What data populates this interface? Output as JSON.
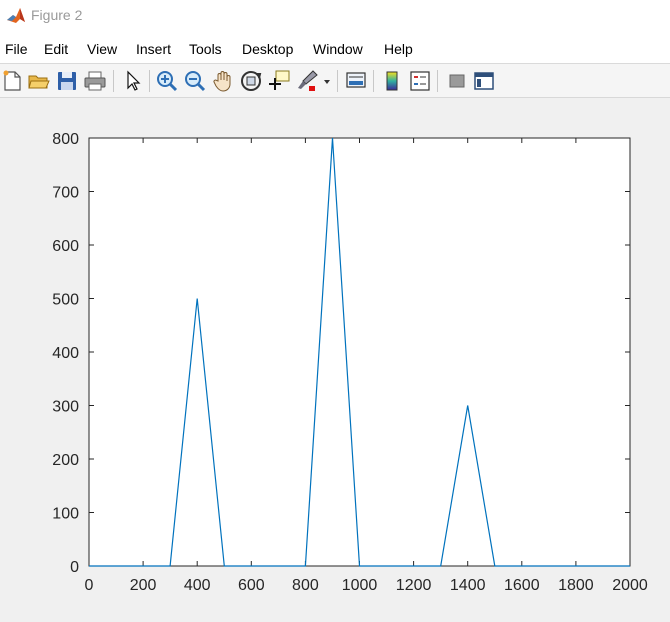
{
  "window": {
    "title": "Figure 2",
    "icon": "matlab-logo-icon"
  },
  "menu": [
    {
      "label": "File"
    },
    {
      "label": "Edit"
    },
    {
      "label": "View"
    },
    {
      "label": "Insert"
    },
    {
      "label": "Tools"
    },
    {
      "label": "Desktop"
    },
    {
      "label": "Window"
    },
    {
      "label": "Help"
    }
  ],
  "toolbar": {
    "icons": [
      "new-figure-icon",
      "open-file-icon",
      "save-icon",
      "print-icon",
      "edit-plot-arrow-icon",
      "zoom-in-icon",
      "zoom-out-icon",
      "pan-hand-icon",
      "rotate-3d-icon",
      "data-cursor-icon",
      "brush-icon",
      "link-plot-icon",
      "insert-colorbar-icon",
      "insert-legend-icon",
      "hide-plot-tools-icon",
      "show-plot-tools-icon"
    ]
  },
  "colors": {
    "line": "#0072bd",
    "axes": "#262626",
    "background": "#f0f0f0"
  },
  "chart_data": {
    "type": "line",
    "x": [
      0,
      300,
      400,
      500,
      800,
      900,
      1000,
      1300,
      1400,
      1500,
      2000
    ],
    "y": [
      0,
      0,
      500,
      0,
      0,
      800,
      0,
      0,
      300,
      0,
      0
    ],
    "xlim": [
      0,
      2000
    ],
    "ylim": [
      0,
      800
    ],
    "xticks": [
      "0",
      "200",
      "400",
      "600",
      "800",
      "1000",
      "1200",
      "1400",
      "1600",
      "1800",
      "2000"
    ],
    "yticks": [
      "0",
      "100",
      "200",
      "300",
      "400",
      "500",
      "600",
      "700",
      "800"
    ],
    "xtick_values": [
      0,
      200,
      400,
      600,
      800,
      1000,
      1200,
      1400,
      1600,
      1800,
      2000
    ],
    "ytick_values": [
      0,
      100,
      200,
      300,
      400,
      500,
      600,
      700,
      800
    ],
    "grid": false,
    "title": "",
    "xlabel": "",
    "ylabel": ""
  }
}
